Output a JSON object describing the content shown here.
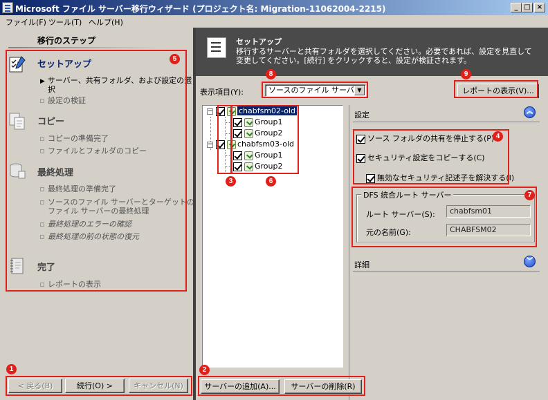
{
  "window": {
    "title": "Microsoft ファイル サーバー移行ウィザード (プロジェクト名: Migration-11062004-2215)",
    "controls": {
      "minimize": "_",
      "maximize": "□",
      "close": "×"
    }
  },
  "menu": [
    "ファイル(F)",
    "ツール(T)",
    "ヘルプ(H)"
  ],
  "steps": {
    "heading": "移行のステップ",
    "setup": {
      "title": "セットアップ",
      "items": [
        "サーバー、共有フォルダ、および設定の選",
        "択",
        "設定の検証"
      ]
    },
    "copy": {
      "title": "コピー",
      "items": [
        "コピーの準備完了",
        "ファイルとフォルダのコピー"
      ]
    },
    "final": {
      "title": "最終処理",
      "items": [
        "最終処理の準備完了",
        "ソースのファイル サーバーとターゲットの",
        "ファイル サーバーの最終処理",
        "最終処理のエラーの確認",
        "最終処理の前の状態の復元"
      ]
    },
    "done": {
      "title": "完了",
      "items": [
        "レポートの表示"
      ]
    }
  },
  "nav_buttons": {
    "back": "< 戻る(B)",
    "next": "続行(O) >",
    "cancel": "キャンセル(N)"
  },
  "header": {
    "title": "セットアップ",
    "description": "移行するサーバーと共有フォルダを選択してください。必要であれば、設定を見直して変更してください。[続行] をクリックすると、設定が検証されます。"
  },
  "display": {
    "label": "表示項目(Y):",
    "selected": "ソースのファイル サーバー",
    "report_button": "レポートの表示(V)..."
  },
  "tree": [
    {
      "label": "chabfsm02-old",
      "selected": true,
      "checked": true,
      "children": [
        "Group1",
        "Group2"
      ]
    },
    {
      "label": "chabfsm03-old",
      "selected": false,
      "checked": true,
      "children": [
        "Group1",
        "Group2"
      ]
    }
  ],
  "settings": {
    "title": "設定",
    "options": [
      {
        "label": "ソース フォルダの共有を停止する(P)",
        "checked": true
      },
      {
        "label": "セキュリティ設定をコピーする(C)",
        "checked": true
      },
      {
        "label": "無効なセキュリティ記述子を解決する(I)",
        "checked": true
      }
    ],
    "dfs": {
      "legend": "DFS 統合ルート サーバー",
      "root_server_label": "ルート サーバー(S):",
      "root_server_value": "chabfsm01",
      "original_name_label": "元の名前(G):",
      "original_name_value": "CHABFSM02"
    },
    "details_title": "詳細"
  },
  "server_buttons": {
    "add": "サーバーの追加(A)...",
    "remove": "サーバーの削除(R)"
  },
  "callouts": [
    "1",
    "2",
    "3",
    "4",
    "5",
    "6",
    "7",
    "8",
    "9"
  ],
  "colors": {
    "callout": "#e0201a",
    "titlebar": "#0a246a",
    "header_bg": "#4a4a4a",
    "step_active": "#0a246a"
  }
}
